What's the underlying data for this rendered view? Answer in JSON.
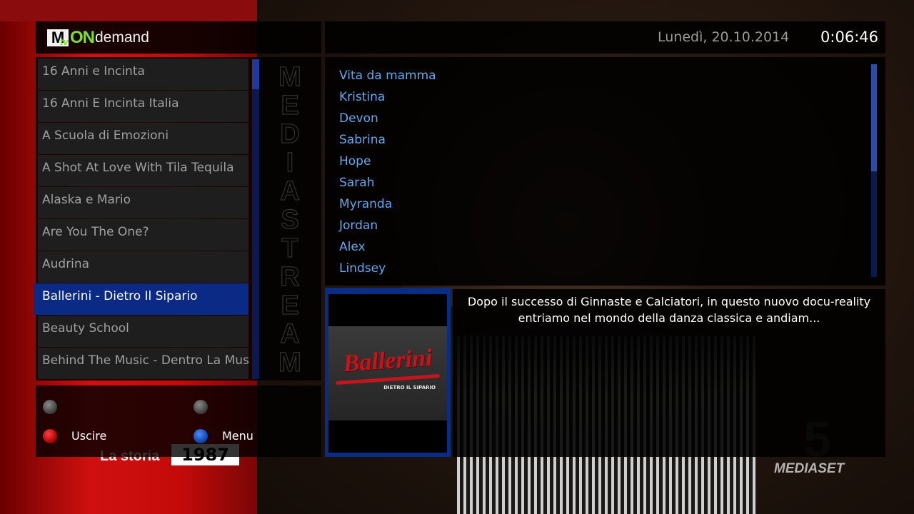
{
  "brand": {
    "mtv": "M",
    "tv": "tv",
    "on": "ON",
    "demand": "demand"
  },
  "header": {
    "date": "Lunedì, 20.10.2014",
    "time": "0:06:46"
  },
  "programs": [
    "16 Anni e Incinta",
    "16 Anni E Incinta Italia",
    "A Scuola di Emozioni",
    "A Shot At Love With Tila Tequila",
    "Alaska e Mario",
    "Are You The One?",
    "Audrina",
    "Ballerini - Dietro Il Sipario",
    "Beauty School",
    "Behind The Music - Dentro La Musica"
  ],
  "selected_program_index": 7,
  "vertical_brand": "MEDIASTREAM",
  "episodes": [
    "Vita da mamma",
    "Kristina",
    "Devon",
    "Sabrina",
    "Hope",
    "Sarah",
    "Myranda",
    "Jordan",
    "Alex",
    "Lindsey"
  ],
  "keys": {
    "red_label": "Uscire",
    "blue_label": "Menu"
  },
  "thumbnail": {
    "title": "Ballerini",
    "subtitle": "DIETRO IL SIPARIO"
  },
  "description": "Dopo il successo di Ginnaste e Calciatori, in questo nuovo docu-reality entriamo nel mondo della danza classica e andiam...",
  "background": {
    "program_logo": "La storia",
    "year": "1987",
    "channel": "MEDIASET",
    "channel_number": "5"
  },
  "colors": {
    "selected_bg": "#0a2a86",
    "episode_text": "#63a8ee",
    "list_text": "#a0a0a0",
    "logo_green": "#7be02b"
  }
}
